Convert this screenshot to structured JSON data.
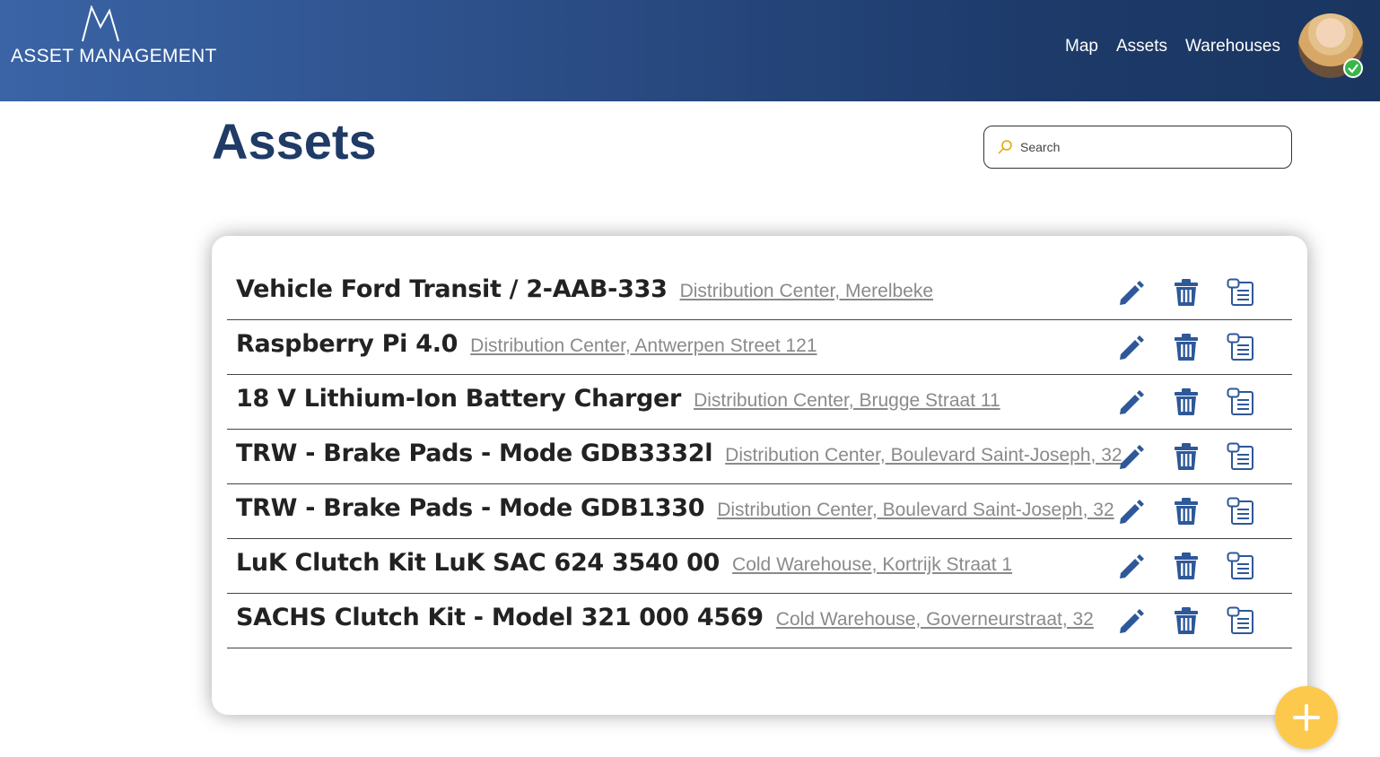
{
  "brand": {
    "name": "ASSET MANAGEMENT",
    "logo_icon": "mountain-peaks-icon"
  },
  "nav": [
    {
      "label": "Map"
    },
    {
      "label": "Assets"
    },
    {
      "label": "Warehouses"
    }
  ],
  "user": {
    "avatar_icon": "user-avatar",
    "status": "online",
    "status_color": "#39b54a"
  },
  "page": {
    "title": "Assets"
  },
  "search": {
    "placeholder": "Search",
    "value": ""
  },
  "assets": [
    {
      "name": "Vehicle Ford Transit / 2-AAB-333",
      "location": "Distribution Center, Merelbeke"
    },
    {
      "name": "Raspberry Pi 4.0",
      "location": "Distribution Center, Antwerpen Street 121"
    },
    {
      "name": "18 V Lithium-Ion Battery Charger",
      "location": "Distribution Center, Brugge Straat 11"
    },
    {
      "name": "TRW - Brake Pads - Mode GDB3332l",
      "location": "Distribution Center, Boulevard Saint-Joseph, 32"
    },
    {
      "name": "TRW - Brake Pads - Mode GDB1330",
      "location": "Distribution Center, Boulevard Saint-Joseph, 32"
    },
    {
      "name": "LuK Clutch Kit LuK SAC 624 3540 00",
      "location": "Cold Warehouse, Kortrijk Straat 1"
    },
    {
      "name": "SACHS Clutch Kit - Model 321 000 4569",
      "location": "Cold Warehouse, Governeurstraat, 32"
    }
  ],
  "row_actions": [
    "edit-icon",
    "trash-icon",
    "clipboard-list-icon"
  ],
  "colors": {
    "header": "#2b4d86",
    "title": "#1f3b66",
    "icon": "#2e5899",
    "fab": "#fcc94d"
  },
  "fab": {
    "icon": "plus-icon"
  }
}
